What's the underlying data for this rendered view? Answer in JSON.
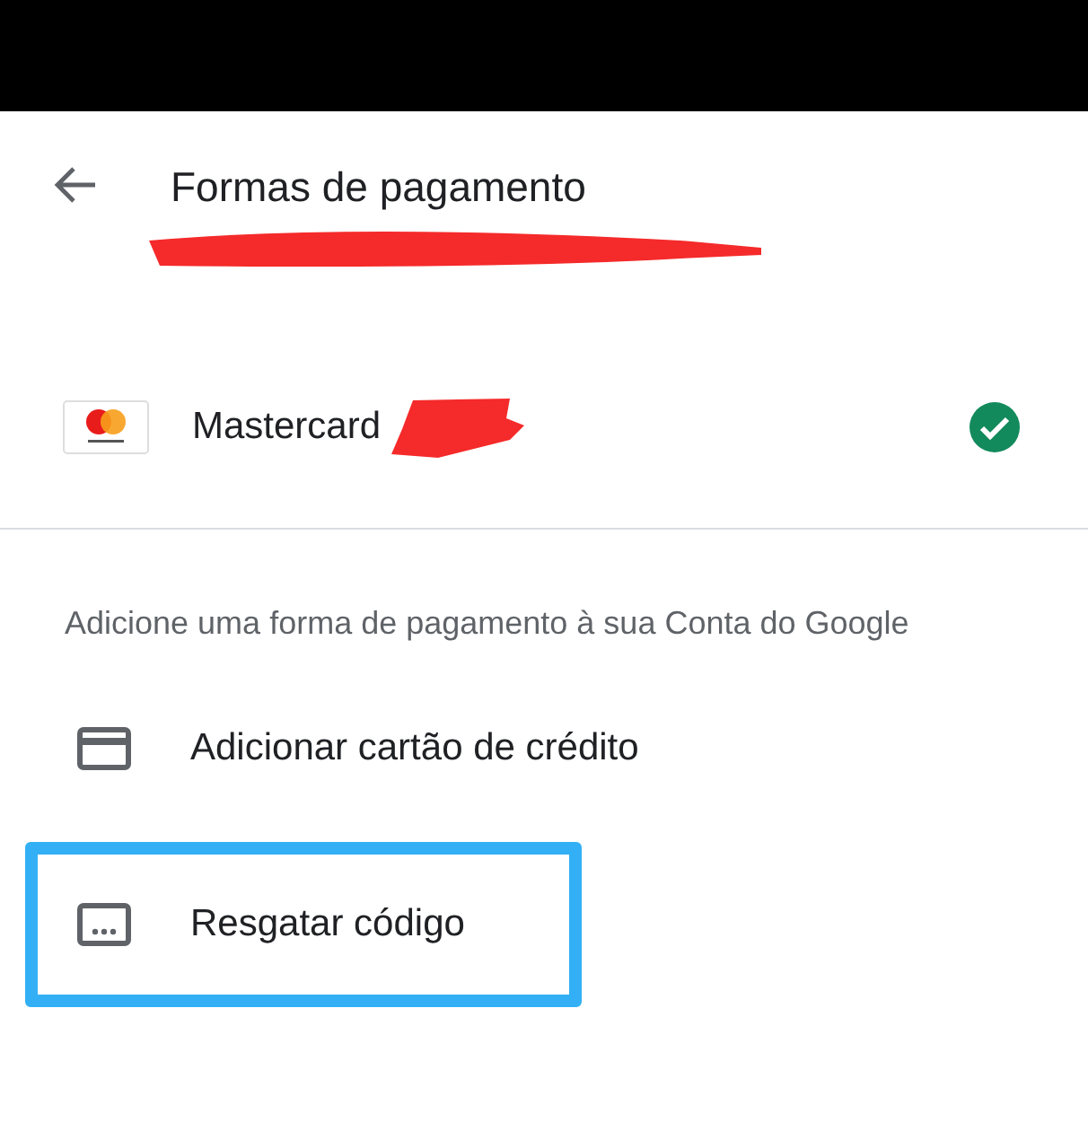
{
  "header": {
    "title": "Formas de pagamento",
    "subtitle_redacted": true
  },
  "methods": [
    {
      "name": "Mastercard",
      "redacted": true,
      "selected": true
    }
  ],
  "hint": "Adicione uma forma de pagamento à sua Conta do Google",
  "actions": [
    {
      "label": "Adicionar cartão de crédito",
      "kind": "card",
      "highlighted": false
    },
    {
      "label": "Resgatar código",
      "kind": "code",
      "highlighted": true
    }
  ]
}
